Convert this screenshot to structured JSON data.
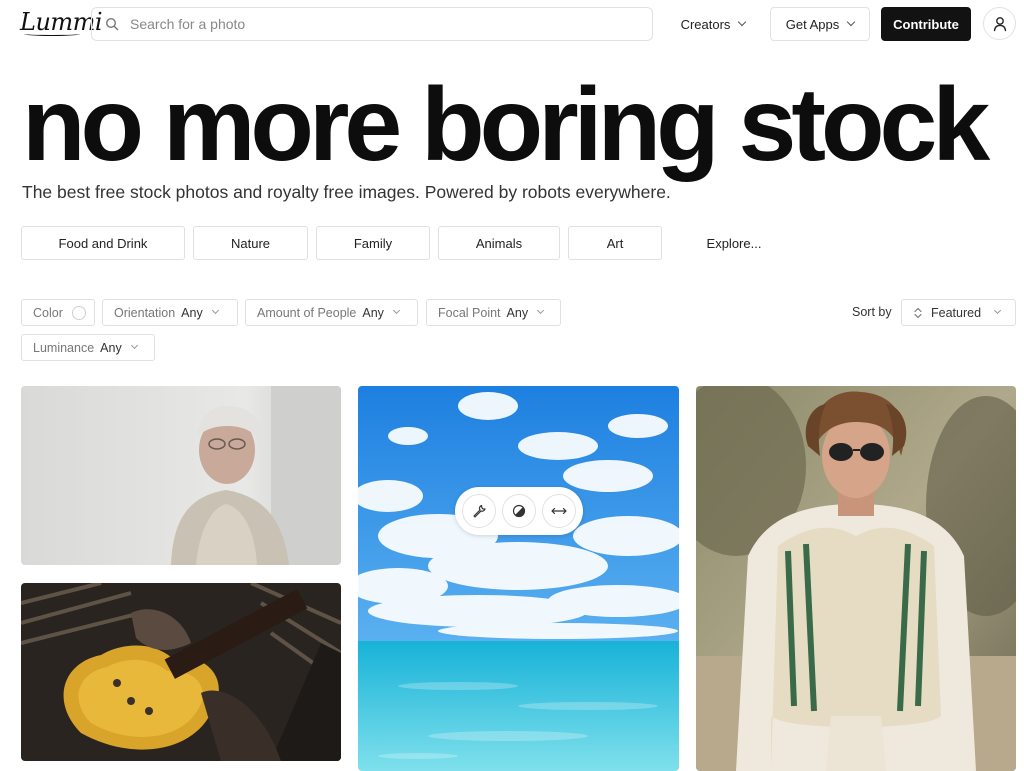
{
  "brand": {
    "logo": "Lummi"
  },
  "header": {
    "search_placeholder": "Search for a photo",
    "creators_label": "Creators",
    "get_apps_label": "Get Apps",
    "contribute_label": "Contribute"
  },
  "hero": {
    "title": "no more boring stock",
    "subtitle": "The best free stock photos and royalty free images. Powered by robots everywhere."
  },
  "categories": [
    "Food and Drink",
    "Nature",
    "Family",
    "Animals",
    "Art",
    "Explore..."
  ],
  "filters": {
    "color_label": "Color",
    "orientation": {
      "label": "Orientation",
      "value": "Any"
    },
    "people": {
      "label": "Amount of People",
      "value": "Any"
    },
    "focal": {
      "label": "Focal Point",
      "value": "Any"
    },
    "luminance": {
      "label": "Luminance",
      "value": "Any"
    }
  },
  "sort": {
    "label": "Sort by",
    "value": "Featured"
  },
  "photos": [
    {
      "subject": "elderly woman in knit cardigan against white wall"
    },
    {
      "subject": "tattooed hands playing a gold electric guitar"
    },
    {
      "subject": "bright blue sky with clouds over turquoise sea"
    },
    {
      "subject": "young man in sunglasses and striped sweater vest"
    }
  ],
  "photo_tools": [
    "wrench-icon",
    "contrast-icon",
    "resize-icon"
  ]
}
